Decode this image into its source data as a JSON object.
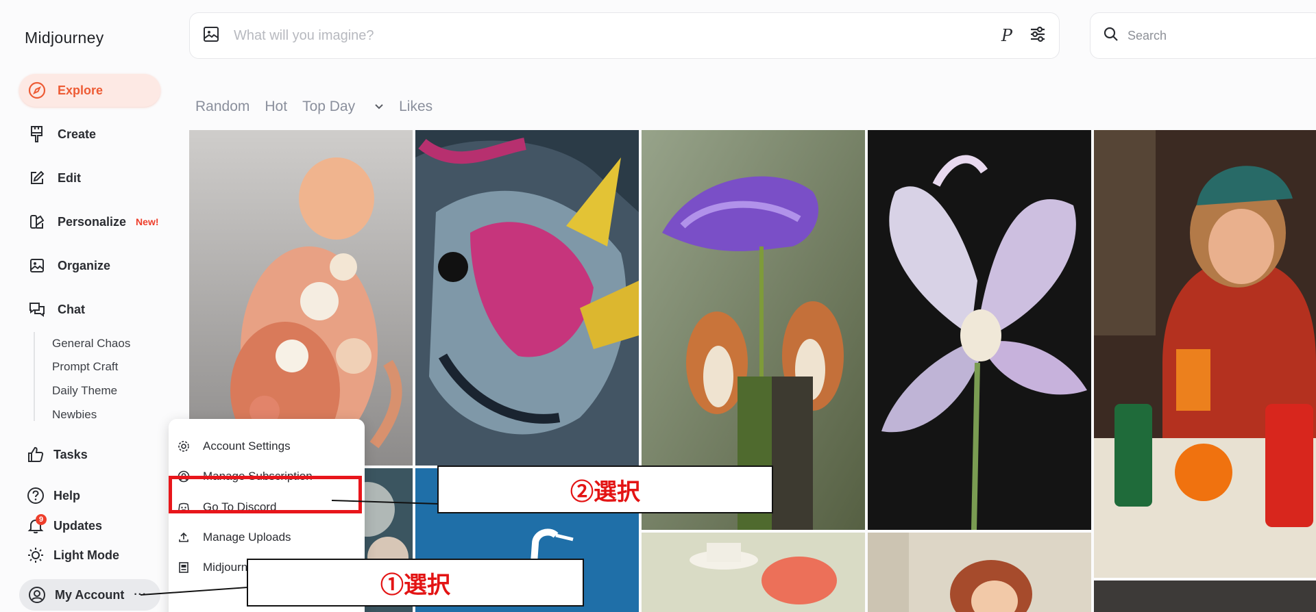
{
  "app": {
    "title": "Midjourney"
  },
  "colors": {
    "accent": "#ed5b34",
    "annotation_red": "#e31414"
  },
  "sidebar": {
    "items": [
      {
        "label": "Explore",
        "icon": "compass-icon",
        "active": true
      },
      {
        "label": "Create",
        "icon": "brush-icon"
      },
      {
        "label": "Edit",
        "icon": "edit-icon"
      },
      {
        "label": "Personalize",
        "icon": "palette-icon",
        "badge": "New!"
      },
      {
        "label": "Organize",
        "icon": "image-icon"
      },
      {
        "label": "Chat",
        "icon": "chat-icon"
      }
    ],
    "chat_rooms": [
      "General Chaos",
      "Prompt Craft",
      "Daily Theme",
      "Newbies"
    ],
    "tasks_label": "Tasks",
    "help_label": "Help",
    "updates_label": "Updates",
    "updates_count": "9",
    "light_mode_label": "Light Mode",
    "account_label": "My Account",
    "account_more": "···"
  },
  "imagine": {
    "placeholder": "What will you imagine?",
    "p_label": "P"
  },
  "search": {
    "placeholder": "Search"
  },
  "filters": {
    "random": "Random",
    "hot": "Hot",
    "top_day": "Top Day",
    "likes": "Likes"
  },
  "menu": {
    "items": [
      {
        "label": "Account Settings",
        "icon": "gear-icon"
      },
      {
        "label": "Manage Subscription",
        "icon": "user-circle-icon"
      },
      {
        "label": "Go To Discord",
        "icon": "discord-icon"
      },
      {
        "label": "Manage Uploads",
        "icon": "upload-icon"
      },
      {
        "label": "Midjourney Magazine",
        "icon": "magazine-icon"
      }
    ]
  },
  "annotations": {
    "step1": "①選択",
    "step2": "②選択"
  }
}
